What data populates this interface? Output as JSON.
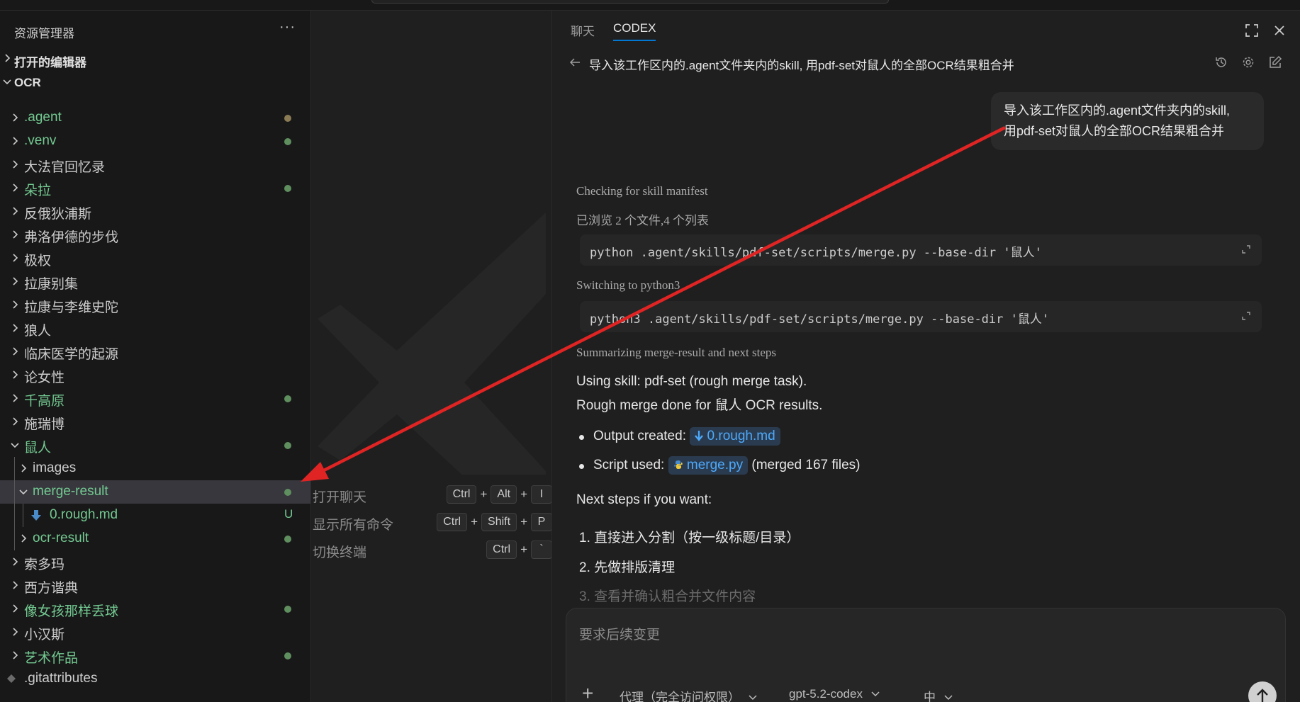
{
  "explorer": {
    "title": "资源管理器",
    "more": "···",
    "open_editors": "打开的编辑器",
    "root": "OCR",
    "items": [
      {
        "label": ".agent",
        "color": "#73c991",
        "dot": "#8a7b55"
      },
      {
        "label": ".venv",
        "color": "#73c991",
        "dot": "#5f8f5f"
      },
      {
        "label": "大法官回忆录",
        "color": "#cccccc"
      },
      {
        "label": "朵拉",
        "color": "#73c991",
        "dot": "#5f8f5f"
      },
      {
        "label": "反俄狄浦斯",
        "color": "#cccccc"
      },
      {
        "label": "弗洛伊德的步伐",
        "color": "#cccccc"
      },
      {
        "label": "极权",
        "color": "#cccccc"
      },
      {
        "label": "拉康别集",
        "color": "#cccccc"
      },
      {
        "label": "拉康与李维史陀",
        "color": "#cccccc"
      },
      {
        "label": "狼人",
        "color": "#cccccc"
      },
      {
        "label": "临床医学的起源",
        "color": "#cccccc"
      },
      {
        "label": "论女性",
        "color": "#cccccc"
      },
      {
        "label": "千高原",
        "color": "#73c991",
        "dot": "#5f8f5f"
      },
      {
        "label": "施瑞博",
        "color": "#cccccc"
      },
      {
        "label": "鼠人",
        "color": "#73c991",
        "dot": "#5f8f5f",
        "open": true
      },
      {
        "label": "images",
        "color": "#cccccc",
        "level": 1
      },
      {
        "label": "merge-result",
        "color": "#73c991",
        "dot": "#5f8f5f",
        "level": 1,
        "open": true,
        "selected": true
      },
      {
        "label": "0.rough.md",
        "color": "#73c991",
        "badge": "U",
        "level": 2,
        "file": true
      },
      {
        "label": "ocr-result",
        "color": "#73c991",
        "dot": "#5f8f5f",
        "level": 1
      },
      {
        "label": "索多玛",
        "color": "#cccccc"
      },
      {
        "label": "西方谐典",
        "color": "#cccccc"
      },
      {
        "label": "像女孩那样丢球",
        "color": "#73c991",
        "dot": "#5f8f5f"
      },
      {
        "label": "小汉斯",
        "color": "#cccccc"
      },
      {
        "label": "艺术作品",
        "color": "#73c991",
        "dot": "#5f8f5f"
      },
      {
        "label": ".gitattributes",
        "color": "#cccccc",
        "file": true,
        "git": true
      }
    ]
  },
  "editor": {
    "shortcuts": [
      {
        "label": "打开聊天",
        "keys": [
          "Ctrl",
          "Alt",
          "I"
        ]
      },
      {
        "label": "显示所有命令",
        "keys": [
          "Ctrl",
          "Shift",
          "P"
        ]
      },
      {
        "label": "切换终端",
        "keys": [
          "Ctrl",
          "`"
        ]
      }
    ]
  },
  "chat": {
    "tabs": [
      "聊天",
      "CODEX"
    ],
    "title": "导入该工作区内的.agent文件夹内的skill, 用pdf-set对鼠人的全部OCR结果粗合并",
    "user_message_line1": "导入该工作区内的.agent文件夹内的skill,",
    "user_message_line2": "用pdf-set对鼠人的全部OCR结果粗合并",
    "step1": "Checking for skill manifest",
    "step2": "已浏览 2 个文件,4 个列表",
    "code1": "python .agent/skills/pdf-set/scripts/merge.py --base-dir '鼠人'",
    "step3": "Switching to python3",
    "code2": "python3 .agent/skills/pdf-set/scripts/merge.py --base-dir '鼠人'",
    "step4": "Summarizing merge-result and next steps",
    "line1": "Using skill: pdf-set (rough merge task).",
    "line2": "Rough merge done for 鼠人 OCR results.",
    "output_label": "Output created:",
    "output_file": "0.rough.md",
    "script_label": "Script used:",
    "script_file": "merge.py",
    "script_note": "(merged 167 files)",
    "next_steps": "Next steps if you want:",
    "next1": "1. 直接进入分割（按一级标题/目录）",
    "next2": "2. 先做排版清理",
    "next3": "3. 查看并确认粗合并文件内容"
  },
  "composer": {
    "placeholder": "要求后续变更",
    "add": "+",
    "mode": "代理（完全访问权限）",
    "model": "gpt-5.2-codex",
    "effort": "中"
  },
  "colors": {
    "accent": "#0078d4",
    "git_added": "#73c991",
    "link": "#4daafc",
    "annotation_arrow": "#e02424"
  }
}
